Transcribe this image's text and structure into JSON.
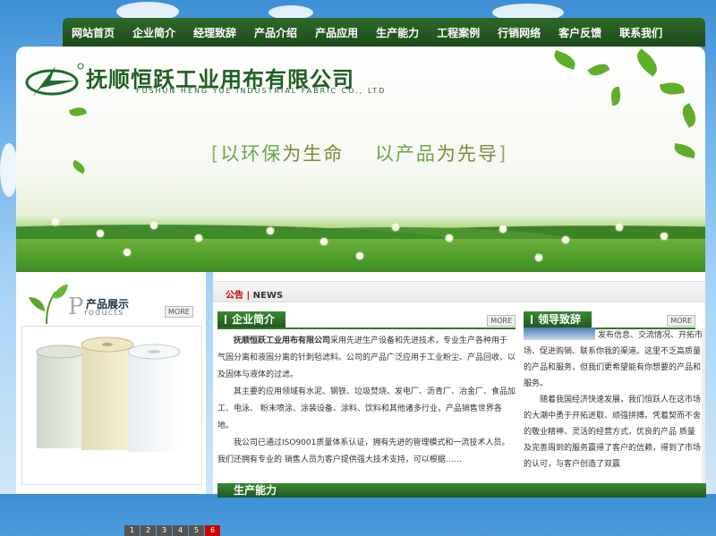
{
  "nav": {
    "items": [
      "网站首页",
      "企业简介",
      "经理致辞",
      "产品介绍",
      "产品应用",
      "生产能力",
      "工程案例",
      "行销网络",
      "客户反馈",
      "联系我们"
    ]
  },
  "banner": {
    "company_cn": "抚顺恒跃工业用布有限公司",
    "company_en": "FUSHUN HENG YUE INDUSTRIAL FABRIC CO., LTD",
    "slogan_open": "[",
    "slogan_p1": "以环保",
    "slogan_p2": "为生命",
    "slogan_p3": "以产品",
    "slogan_p4": "为先导",
    "slogan_close": "]"
  },
  "products": {
    "title": "产品展示",
    "big_letter": "P",
    "subtitle": "roducts",
    "more": "MORE",
    "pages": [
      "1",
      "2",
      "3",
      "4",
      "5",
      "6"
    ],
    "active_page": "6"
  },
  "notice": {
    "label_cn": "公告",
    "sep": "|",
    "label_en": "NEWS"
  },
  "intro": {
    "title": "企业简介",
    "more": "MORE",
    "p1_company": "抚顺恒跃工业用布有限公司",
    "p1_rest": "采用先进生产设备和先进技术，专业生产各种用于气固分离和液固分离的针刺毡滤料。公司的产品广泛应用于工业粉尘、产品回收、以及固体与液体的过滤。",
    "p2": "其主要的应用领域有水泥、钢铁、垃圾焚烧、发电厂、沥青厂、冶金厂、食品加工、电泳、 粉末喷涂、涂装设备、涂料、饮料和其他诸多行业，产品销售世界各地。",
    "p3": "我公司已通过ISO9001质量体系认证，拥有先进的管理模式和一流技术人员。我们还拥有专业的 销售人员为客户提供强大技术支持，可以根据……"
  },
  "leader": {
    "title": "领导致辞",
    "more": "MORE",
    "p1": "发布信息、交流情况、开拓市场、促进购销、联系你我的渠道。这里不乏高质量的产品和服务，但我们更希望能有你想要的产品和服务。",
    "p2": "随着我国经济快速发展，我们恒跃人在这市场的大潮中勇于开拓进取、顽强拼搏。凭着契而不舍的敬业精神、灵活的经营方式，优良的产品 质量及完善周到的服务赢得了客户的信赖，得到了市场的认可，与客户创造了双赢"
  },
  "bottom": {
    "title": "生产能力"
  },
  "colors": {
    "nav_green": "#1d4a1a",
    "brand_green": "#2f7a28",
    "accent_red": "#cc0000"
  }
}
